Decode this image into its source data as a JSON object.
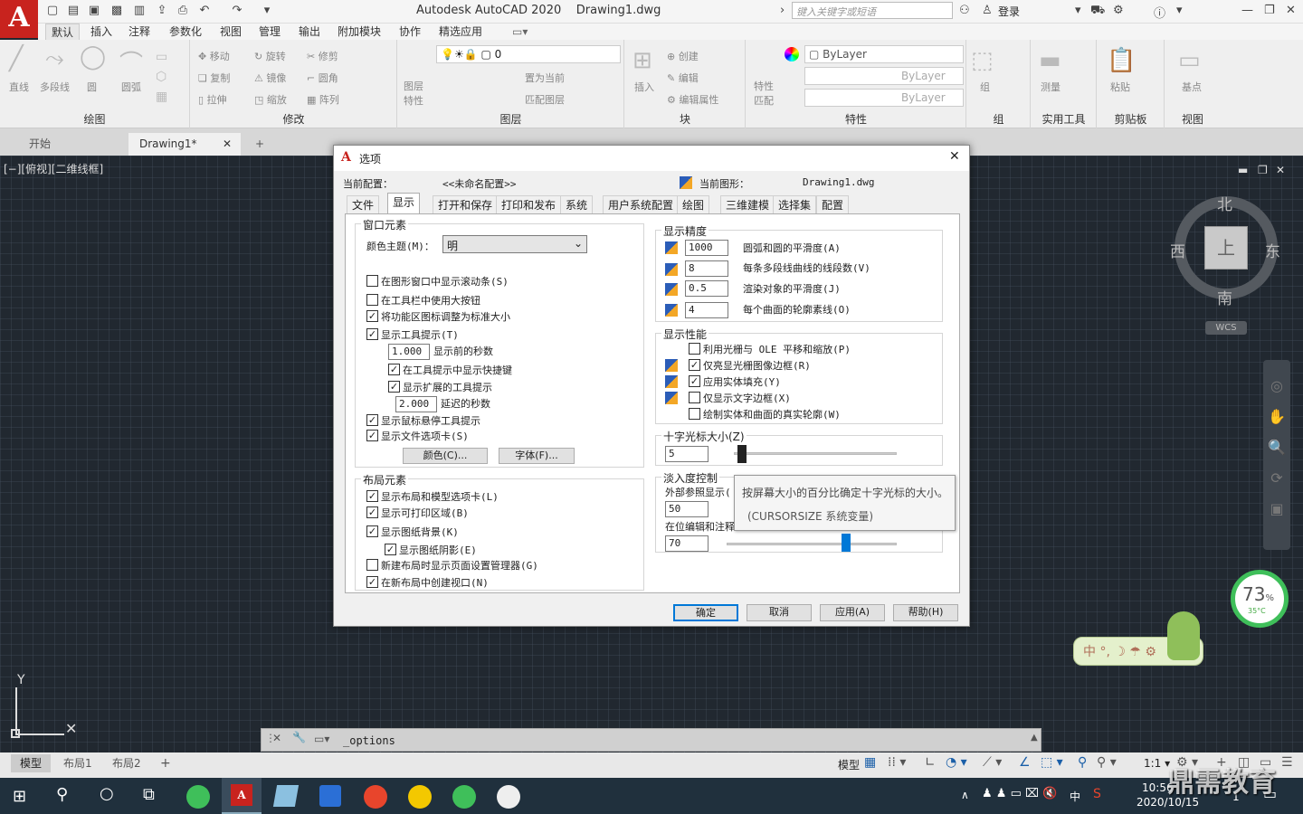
{
  "app": {
    "title": "Autodesk AutoCAD 2020",
    "filename": "Drawing1.dwg",
    "search_placeholder": "键入关键字或短语",
    "login": "登录",
    "logo": "A"
  },
  "ribbon_tabs": [
    "默认",
    "插入",
    "注释",
    "参数化",
    "视图",
    "管理",
    "输出",
    "附加模块",
    "协作",
    "精选应用"
  ],
  "ribbon": {
    "draw": {
      "title": "绘图",
      "items": [
        "直线",
        "多段线",
        "圆",
        "圆弧"
      ]
    },
    "modify": {
      "title": "修改",
      "items": [
        "移动",
        "旋转",
        "修剪",
        "复制",
        "镜像",
        "圆角",
        "拉伸",
        "缩放",
        "阵列"
      ]
    },
    "layers": {
      "title": "图层",
      "layer_props": "图层\n特性",
      "layer_value": "0",
      "items": [
        "置为当前",
        "匹配图层"
      ]
    },
    "block": {
      "title": "块",
      "insert": "插入",
      "items": [
        "创建",
        "编辑",
        "编辑属性"
      ]
    },
    "properties": {
      "title": "特性",
      "match": "特性\n匹配",
      "bylayer": "ByLayer"
    },
    "group": {
      "title": "组",
      "label": "组"
    },
    "utilities": {
      "title": "实用工具",
      "label": "测量"
    },
    "clipboard": {
      "title": "剪贴板",
      "label": "粘贴"
    },
    "view": {
      "title": "视图",
      "label": "基点"
    }
  },
  "doc_tabs": [
    "开始",
    "Drawing1*"
  ],
  "viewport_label": "[−][俯视][二维线框]",
  "viewcube": {
    "n": "北",
    "s": "南",
    "e": "东",
    "w": "西",
    "top": "上",
    "wcs": "WCS"
  },
  "dialog": {
    "title": "选项",
    "current_profile_label": "当前配置：",
    "current_profile_value": "<<未命名配置>>",
    "current_drawing_label": "当前图形：",
    "current_drawing_value": "Drawing1.dwg",
    "tabs": [
      "文件",
      "显示",
      "打开和保存",
      "打印和发布",
      "系统",
      "用户系统配置",
      "绘图",
      "三维建模",
      "选择集",
      "配置"
    ],
    "window_elements": {
      "title": "窗口元素",
      "color_theme_label": "颜色主题(M)：",
      "color_theme_value": "明",
      "checks": [
        {
          "label": "在图形窗口中显示滚动条(S)",
          "checked": false
        },
        {
          "label": "在工具栏中使用大按钮",
          "checked": false
        },
        {
          "label": "将功能区图标调整为标准大小",
          "checked": true
        },
        {
          "label": "显示工具提示(T)",
          "checked": true
        }
      ],
      "tooltip_seconds": "1.000",
      "tooltip_seconds_label": "显示前的秒数",
      "sub_checks": [
        {
          "label": "在工具提示中显示快捷键",
          "checked": true
        },
        {
          "label": "显示扩展的工具提示",
          "checked": true
        }
      ],
      "delay_seconds": "2.000",
      "delay_label": "延迟的秒数",
      "checks2": [
        {
          "label": "显示鼠标悬停工具提示",
          "checked": true
        },
        {
          "label": "显示文件选项卡(S)",
          "checked": true
        }
      ],
      "colors_btn": "颜色(C)...",
      "fonts_btn": "字体(F)..."
    },
    "layout_elements": {
      "title": "布局元素",
      "checks": [
        {
          "label": "显示布局和模型选项卡(L)",
          "checked": true
        },
        {
          "label": "显示可打印区域(B)",
          "checked": true
        },
        {
          "label": "显示图纸背景(K)",
          "checked": true
        },
        {
          "label": "显示图纸阴影(E)",
          "checked": true
        },
        {
          "label": "新建布局时显示页面设置管理器(G)",
          "checked": false
        },
        {
          "label": "在新布局中创建视口(N)",
          "checked": true
        }
      ]
    },
    "display_resolution": {
      "title": "显示精度",
      "rows": [
        {
          "value": "1000",
          "label": "圆弧和圆的平滑度(A)"
        },
        {
          "value": "8",
          "label": "每条多段线曲线的线段数(V)"
        },
        {
          "value": "0.5",
          "label": "渲染对象的平滑度(J)"
        },
        {
          "value": "4",
          "label": "每个曲面的轮廓素线(O)"
        }
      ]
    },
    "display_performance": {
      "title": "显示性能",
      "checks": [
        {
          "label": "利用光栅与 OLE 平移和缩放(P)",
          "checked": false
        },
        {
          "label": "仅亮显光栅图像边框(R)",
          "checked": true
        },
        {
          "label": "应用实体填充(Y)",
          "checked": true
        },
        {
          "label": "仅显示文字边框(X)",
          "checked": false
        },
        {
          "label": "绘制实体和曲面的真实轮廓(W)",
          "checked": false
        }
      ]
    },
    "crosshair": {
      "title": "十字光标大小(Z)",
      "value": "5",
      "fraction": 0.05
    },
    "fade": {
      "title": "淡入度控制",
      "xref_label": "外部参照显示(",
      "xref_value": "50",
      "inplace_label": "在位编辑和注释",
      "inplace_value": "70",
      "inplace_fraction": 0.7
    },
    "tooltip": {
      "line1": "按屏幕大小的百分比确定十字光标的大小。",
      "line2": "(CURSORSIZE 系统变量)"
    },
    "buttons": {
      "ok": "确定",
      "cancel": "取消",
      "apply": "应用(A)",
      "help": "帮助(H)"
    }
  },
  "command": "_options",
  "layout_tabs": [
    "模型",
    "布局1",
    "布局2"
  ],
  "status": {
    "model": "模型",
    "scale": "1:1"
  },
  "widget": {
    "percent": "73",
    "unit": "%",
    "temp": "35°C",
    "ime": "中"
  },
  "taskbar": {
    "time": "10:56",
    "date": "2020/10/15",
    "ime": "中"
  },
  "watermark": "鼎需教育"
}
